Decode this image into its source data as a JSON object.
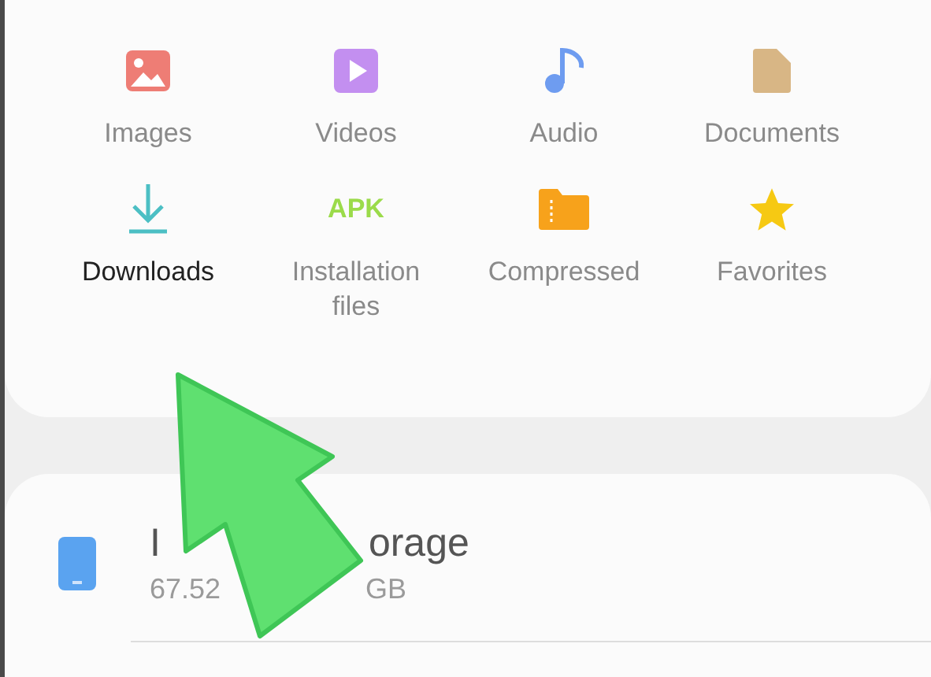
{
  "categories": [
    {
      "kind": "images",
      "label": "Images",
      "focused": false
    },
    {
      "kind": "videos",
      "label": "Videos",
      "focused": false
    },
    {
      "kind": "audio",
      "label": "Audio",
      "focused": false
    },
    {
      "kind": "documents",
      "label": "Documents",
      "focused": false
    },
    {
      "kind": "downloads",
      "label": "Downloads",
      "focused": true
    },
    {
      "kind": "apk",
      "label": "Installation files",
      "focused": false,
      "icon_text": "APK"
    },
    {
      "kind": "compressed",
      "label": "Compressed",
      "focused": false
    },
    {
      "kind": "favorites",
      "label": "Favorites",
      "focused": false
    }
  ],
  "storage": {
    "title_parts": [
      "I",
      "orage"
    ],
    "subtitle_parts": [
      "67.52",
      "GB"
    ]
  }
}
